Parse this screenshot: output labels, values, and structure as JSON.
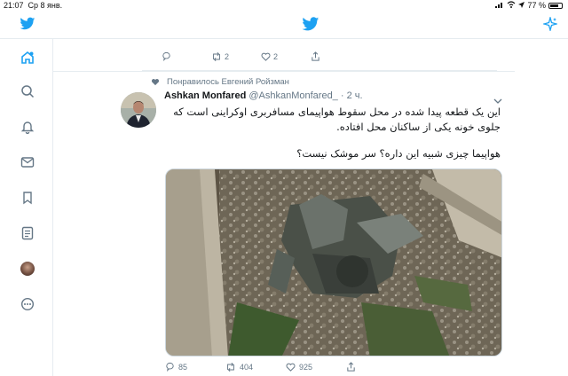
{
  "status": {
    "time": "21:07",
    "date": "Ср 8 янв.",
    "battery": "77 %",
    "battery_level": 0.77
  },
  "nav": {
    "items": [
      "home",
      "explore",
      "notifications",
      "messages",
      "bookmarks",
      "lists",
      "profile",
      "more"
    ]
  },
  "previous_tweet": {
    "retweets": "2",
    "likes": "2"
  },
  "tweet": {
    "social_context": "Понравилось Евгений Ройзман",
    "author_name": "Ashkan Monfared",
    "author_handle": "@AshkanMonfared_",
    "time_sep": "·",
    "time": "2 ч.",
    "text_line1": "این یک قطعه پیدا شده در محل سقوط هواپیمای مسافربری اوکراینی است که جلوی خونه یکی از ساکنان محل افتاده.",
    "text_line2": "هواپیما چیزی شبیه این داره؟ سر موشک نیست؟",
    "replies": "85",
    "retweets": "404",
    "likes": "925"
  },
  "colors": {
    "accent": "#1da1f2",
    "muted": "#657786",
    "border": "#e6ecf0"
  }
}
